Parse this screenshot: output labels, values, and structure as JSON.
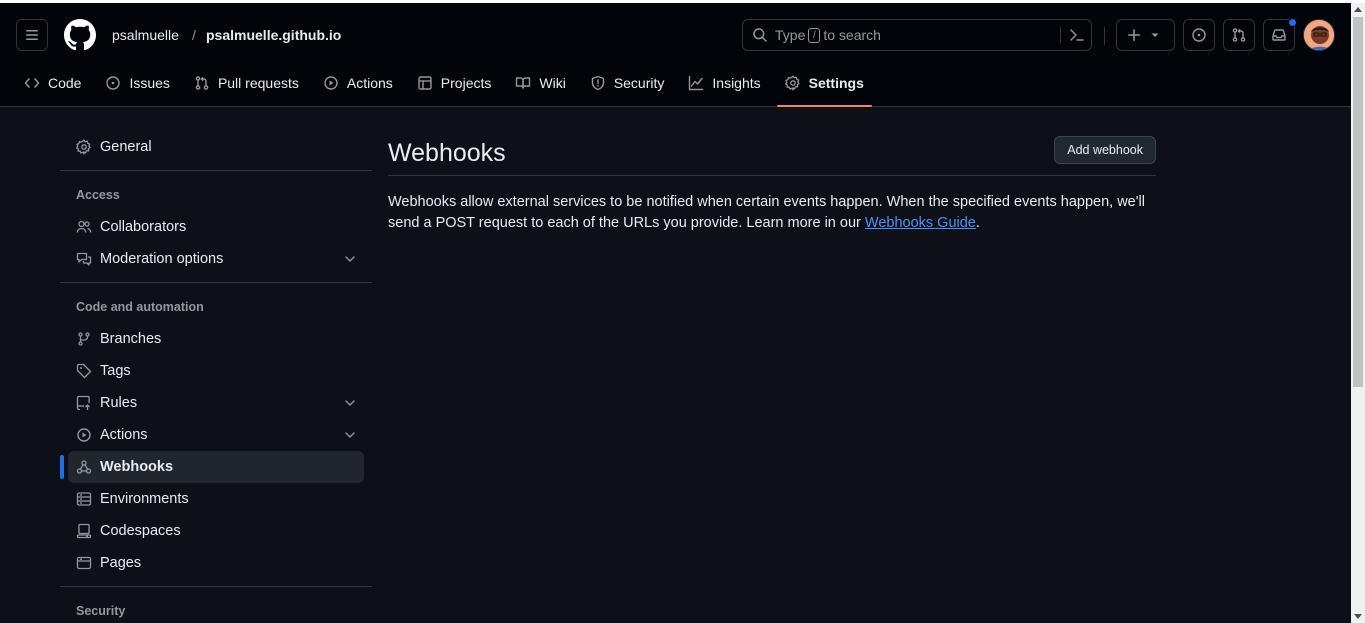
{
  "header": {
    "owner": "psalmuelle",
    "separator": "/",
    "repo": "psalmuelle.github.io",
    "search": {
      "prefix": "Type",
      "key": "/",
      "suffix": "to search"
    },
    "icons": [
      "hamburger-icon",
      "github-logo",
      "search-icon",
      "command-palette-icon",
      "plus-icon",
      "issues-icon",
      "pull-requests-icon",
      "inbox-icon"
    ]
  },
  "tabs": [
    {
      "label": "Code",
      "icon": "code-icon"
    },
    {
      "label": "Issues",
      "icon": "issue-icon"
    },
    {
      "label": "Pull requests",
      "icon": "pull-request-icon"
    },
    {
      "label": "Actions",
      "icon": "play-icon"
    },
    {
      "label": "Projects",
      "icon": "table-icon"
    },
    {
      "label": "Wiki",
      "icon": "book-icon"
    },
    {
      "label": "Security",
      "icon": "shield-icon"
    },
    {
      "label": "Insights",
      "icon": "graph-icon"
    },
    {
      "label": "Settings",
      "icon": "gear-icon",
      "selected": true
    }
  ],
  "sidebar": {
    "general": "General",
    "access_heading": "Access",
    "collaborators": "Collaborators",
    "moderation": "Moderation options",
    "code_heading": "Code and automation",
    "branches": "Branches",
    "tags": "Tags",
    "rules": "Rules",
    "actions": "Actions",
    "webhooks": "Webhooks",
    "environments": "Environments",
    "codespaces": "Codespaces",
    "pages": "Pages",
    "security_heading": "Security"
  },
  "main": {
    "title": "Webhooks",
    "add_button": "Add webhook",
    "description_1": "Webhooks allow external services to be notified when certain events happen. When the specified events happen, we'll send a POST request to each of the URLs you provide. Learn more in our ",
    "link": "Webhooks Guide",
    "description_end": "."
  },
  "colors": {
    "background": "#0d1117",
    "header_bg": "#010409",
    "accent_tab": "#f78166",
    "accent_blue": "#1f6feb",
    "link": "#4493f8"
  }
}
